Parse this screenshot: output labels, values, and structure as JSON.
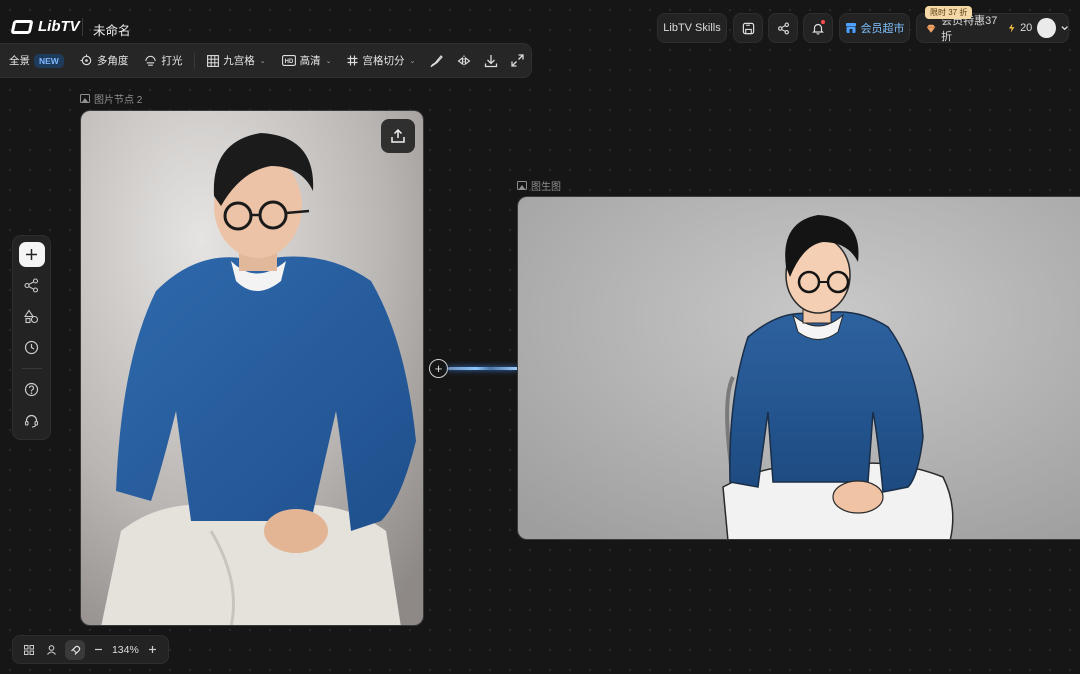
{
  "app": {
    "logo_text": "LibTV",
    "project_title": "未命名"
  },
  "header": {
    "skills_label": "LibTV Skills",
    "member_market_label": "会员超市",
    "promo_badge": "限时 37 折",
    "member_offer_label": "会员特惠37折",
    "credits": "20"
  },
  "toolbar": {
    "panorama_label": "全景",
    "new_badge": "NEW",
    "multi_angle_label": "多角度",
    "lighting_label": "打光",
    "nine_grid_label": "九宫格",
    "hd_label": "高清",
    "grid_cut_label": "宫格切分"
  },
  "nodes": {
    "source": {
      "label": "图片节点 2"
    },
    "target": {
      "label": "图生图"
    }
  },
  "bottom_bar": {
    "zoom": "134%"
  },
  "colors": {
    "background": "#161616",
    "accent": "#4da3ff",
    "sweater_blue": "#2a5d9b"
  }
}
